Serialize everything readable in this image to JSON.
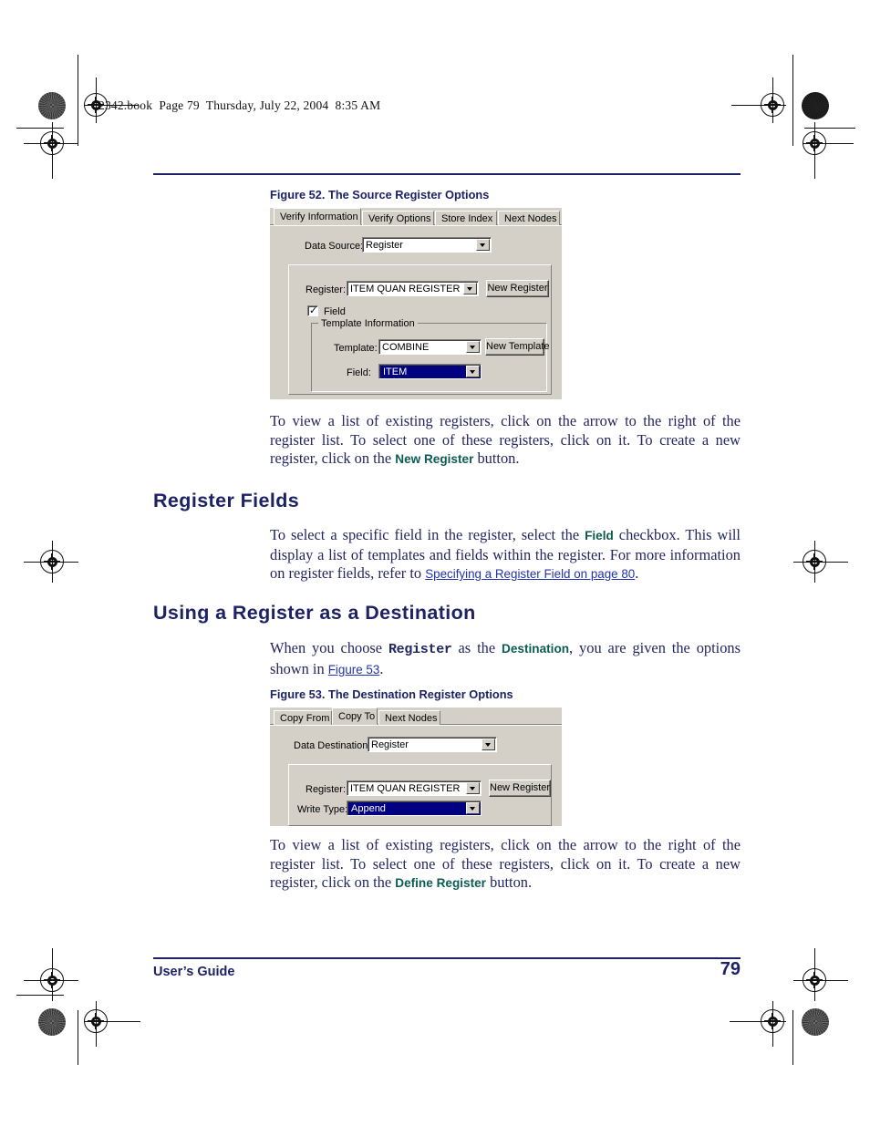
{
  "page": {
    "book_header": "2342.book  Page 79  Thursday, July 22, 2004  8:35 AM",
    "footer_left": "User’s Guide",
    "footer_page": "79"
  },
  "colors": {
    "heading": "#1d2266",
    "body": "#23275f",
    "gui_term": "#0d5c52",
    "link": "#2233aa",
    "dialog_face": "#d4d0c8",
    "selection": "#000080"
  },
  "figure52": {
    "caption": "Figure 52. The Source Register Options",
    "tabs": [
      {
        "label": "Verify Information",
        "active": true
      },
      {
        "label": "Verify Options",
        "active": false
      },
      {
        "label": "Store Index",
        "active": false
      },
      {
        "label": "Next Nodes",
        "active": false
      }
    ],
    "data_source_label": "Data Source:",
    "data_source_value": "Register",
    "register_label": "Register:",
    "register_value": "ITEM QUAN REGISTER",
    "new_register_button": "New Register",
    "field_checkbox_label": "Field",
    "field_checkbox_checked": true,
    "template_group_label": "Template Information",
    "template_label": "Template:",
    "template_value": "COMBINE",
    "new_template_button": "New Template",
    "field_label": "Field:",
    "field_value": "ITEM"
  },
  "figure53": {
    "caption": "Figure 53. The Destination Register Options",
    "tabs": [
      {
        "label": "Copy From",
        "active": false
      },
      {
        "label": "Copy To",
        "active": true
      },
      {
        "label": "Next Nodes",
        "active": false
      }
    ],
    "data_destination_label": "Data Destination:",
    "data_destination_value": "Register",
    "register_label": "Register:",
    "register_value": "ITEM QUAN REGISTER",
    "new_register_button": "New Register",
    "write_type_label": "Write Type:",
    "write_type_value": "Append"
  },
  "paragraphs": {
    "p1": {
      "part1": "To view a list of existing registers, click on the arrow to the right of the register list. To select one of these registers, click on it. To create a new register, click on the ",
      "gui": "New Register",
      "part2": " button."
    },
    "p2": {
      "part1": "To select a specific field in the register, select the ",
      "gui": "Field",
      "part2": " checkbox. This will display a list of templates and fields within the register. For more information on register fields, refer to ",
      "link": "Specifying a Register Field on page 80",
      "part3": "."
    },
    "p3": {
      "part1": "When you choose ",
      "mono": "Register",
      "part2": " as the ",
      "gui": "Destination",
      "part3": ", you are given the options shown in ",
      "link": "Figure 53",
      "part4": "."
    },
    "p4": {
      "part1": "To view a list of existing registers, click on the arrow to the right of the register list. To select one of these registers, click on it. To create a new register, click on the ",
      "gui": "Define Register",
      "part2": " button."
    }
  },
  "headings": {
    "register_fields": "Register Fields",
    "using_register_destination": "Using a Register as a Destination"
  }
}
